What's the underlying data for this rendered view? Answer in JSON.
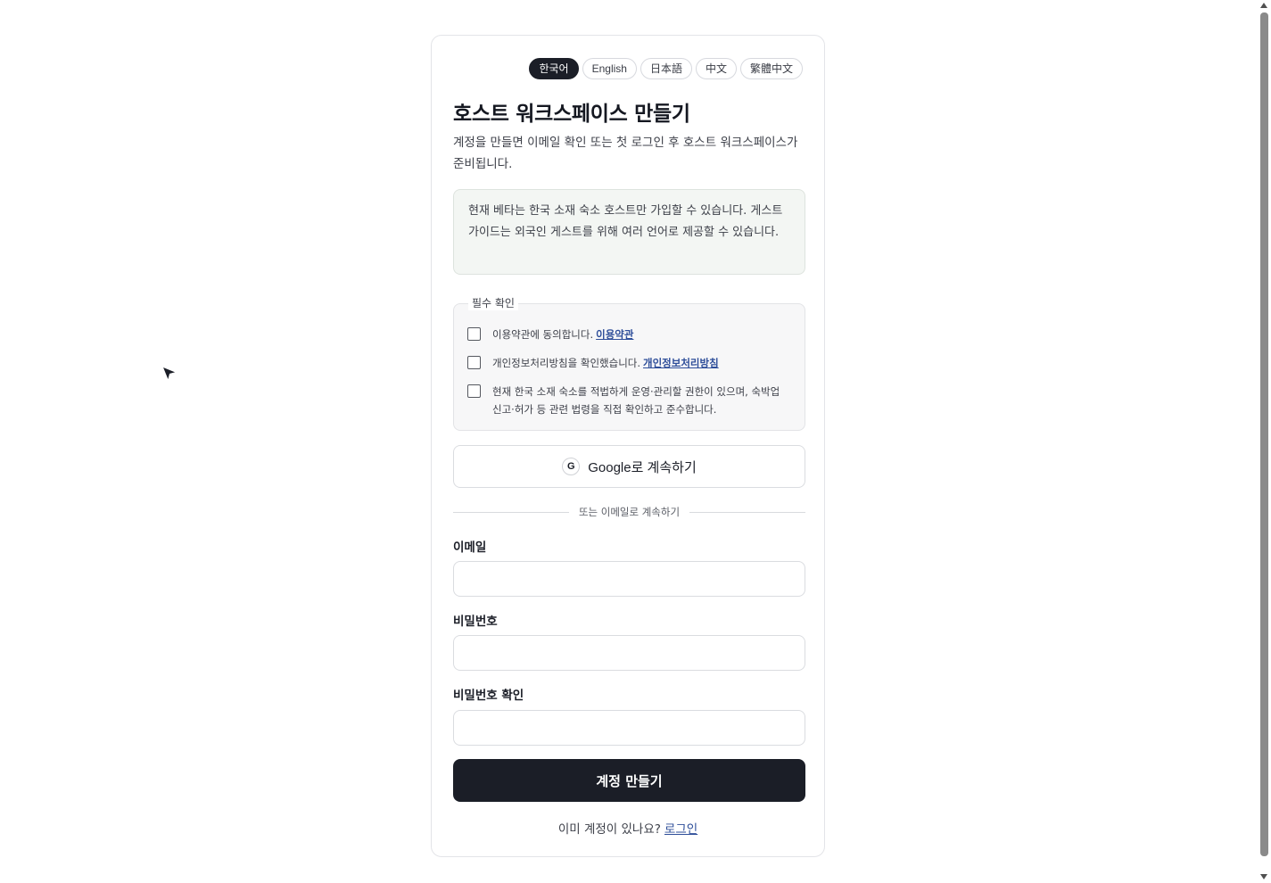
{
  "languages": [
    "한국어",
    "English",
    "日本語",
    "中文",
    "繁體中文"
  ],
  "title": "호스트 워크스페이스 만들기",
  "subtitle": "계정을 만들면 이메일 확인 또는 첫 로그인 후 호스트 워크스페이스가 준비됩니다.",
  "notice": "현재 베타는 한국 소재 숙소 호스트만 가입할 수 있습니다. 게스트 가이드는 외국인 게스트를 위해 여러 언어로 제공할 수 있습니다.",
  "consent": {
    "legend": "필수 확인",
    "terms_text": "이용약관에 동의합니다.",
    "terms_link": "이용약관",
    "privacy_text": "개인정보처리방침을 확인했습니다.",
    "privacy_link": "개인정보처리방침",
    "authority_text": "현재 한국 소재 숙소를 적법하게 운영·관리할 권한이 있으며, 숙박업 신고·허가 등 관련 법령을 직접 확인하고 준수합니다."
  },
  "google_icon": "G",
  "google_button": "Google로 계속하기",
  "divider": "또는 이메일로 계속하기",
  "fields": {
    "email_label": "이메일",
    "password_label": "비밀번호",
    "confirm_label": "비밀번호 확인"
  },
  "submit": "계정 만들기",
  "login_prompt": "이미 계정이 있나요?",
  "login_link": "로그인"
}
